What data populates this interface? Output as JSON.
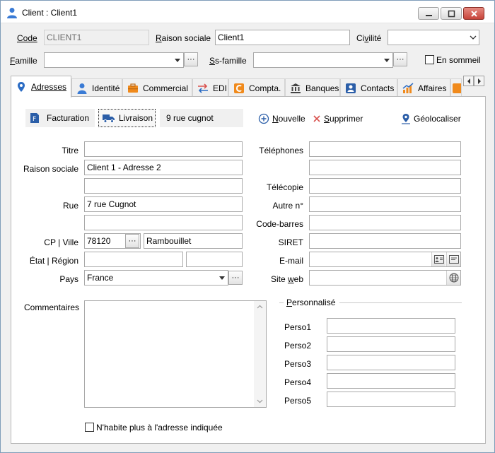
{
  "window": {
    "title": "Client : Client1"
  },
  "header": {
    "code_label": "Code",
    "code_value": "CLIENT1",
    "raison_label": "Raison sociale",
    "raison_value": "Client1",
    "civilite_label": "Civilité",
    "civilite_value": "",
    "famille_label": "Famille",
    "famille_value": "",
    "ssfamille_label": "Ss-famille",
    "ssfamille_value": "",
    "sommeil_label": "En sommeil",
    "sommeil_checked": false
  },
  "tabs": [
    {
      "label": "Adresses",
      "icon": "map-pin-icon",
      "active": true
    },
    {
      "label": "Identité",
      "icon": "person-icon"
    },
    {
      "label": "Commercial",
      "icon": "briefcase-icon"
    },
    {
      "label": "EDI",
      "icon": "exchange-icon"
    },
    {
      "label": "Compta.",
      "icon": "compta-icon"
    },
    {
      "label": "Banques",
      "icon": "bank-icon"
    },
    {
      "label": "Contacts",
      "icon": "contact-card-icon"
    },
    {
      "label": "Affaires",
      "icon": "chart-icon"
    }
  ],
  "address_bar": {
    "facturation": "Facturation",
    "livraison": "Livraison",
    "address_summary": "9 rue cugnot",
    "nouvelle": "Nouvelle",
    "supprimer": "Supprimer",
    "geolocaliser": "Géolocaliser"
  },
  "left_form": {
    "titre_label": "Titre",
    "titre_value": "",
    "raison_label": "Raison sociale",
    "raison_value": "Client 1 - Adresse 2",
    "raison2_value": "",
    "rue_label": "Rue",
    "rue_value": "7 rue Cugnot",
    "rue2_value": "",
    "cp_ville_label": "CP | Ville",
    "cp_value": "78120",
    "ville_value": "Rambouillet",
    "etat_region_label": "État | Région",
    "etat_value": "",
    "region_value": "",
    "pays_label": "Pays",
    "pays_value": "France",
    "commentaires_label": "Commentaires",
    "commentaires_value": ""
  },
  "right_form": {
    "telephones_label": "Téléphones",
    "telecopie_label": "Télécopie",
    "autre_label": "Autre n°",
    "codebarres_label": "Code-barres",
    "siret_label": "SIRET",
    "email_label": "E-mail",
    "siteweb_label": "Site web"
  },
  "personnalise": {
    "title": "Personnalisé",
    "fields": [
      "Perso1",
      "Perso2",
      "Perso3",
      "Perso4",
      "Perso5"
    ]
  },
  "footer": {
    "nhabite_label": "N'habite plus à l'adresse indiquée"
  },
  "colors": {
    "accent": "#2b5ea8",
    "delete_red": "#d9534f",
    "tab_orange": "#f08a1c"
  }
}
